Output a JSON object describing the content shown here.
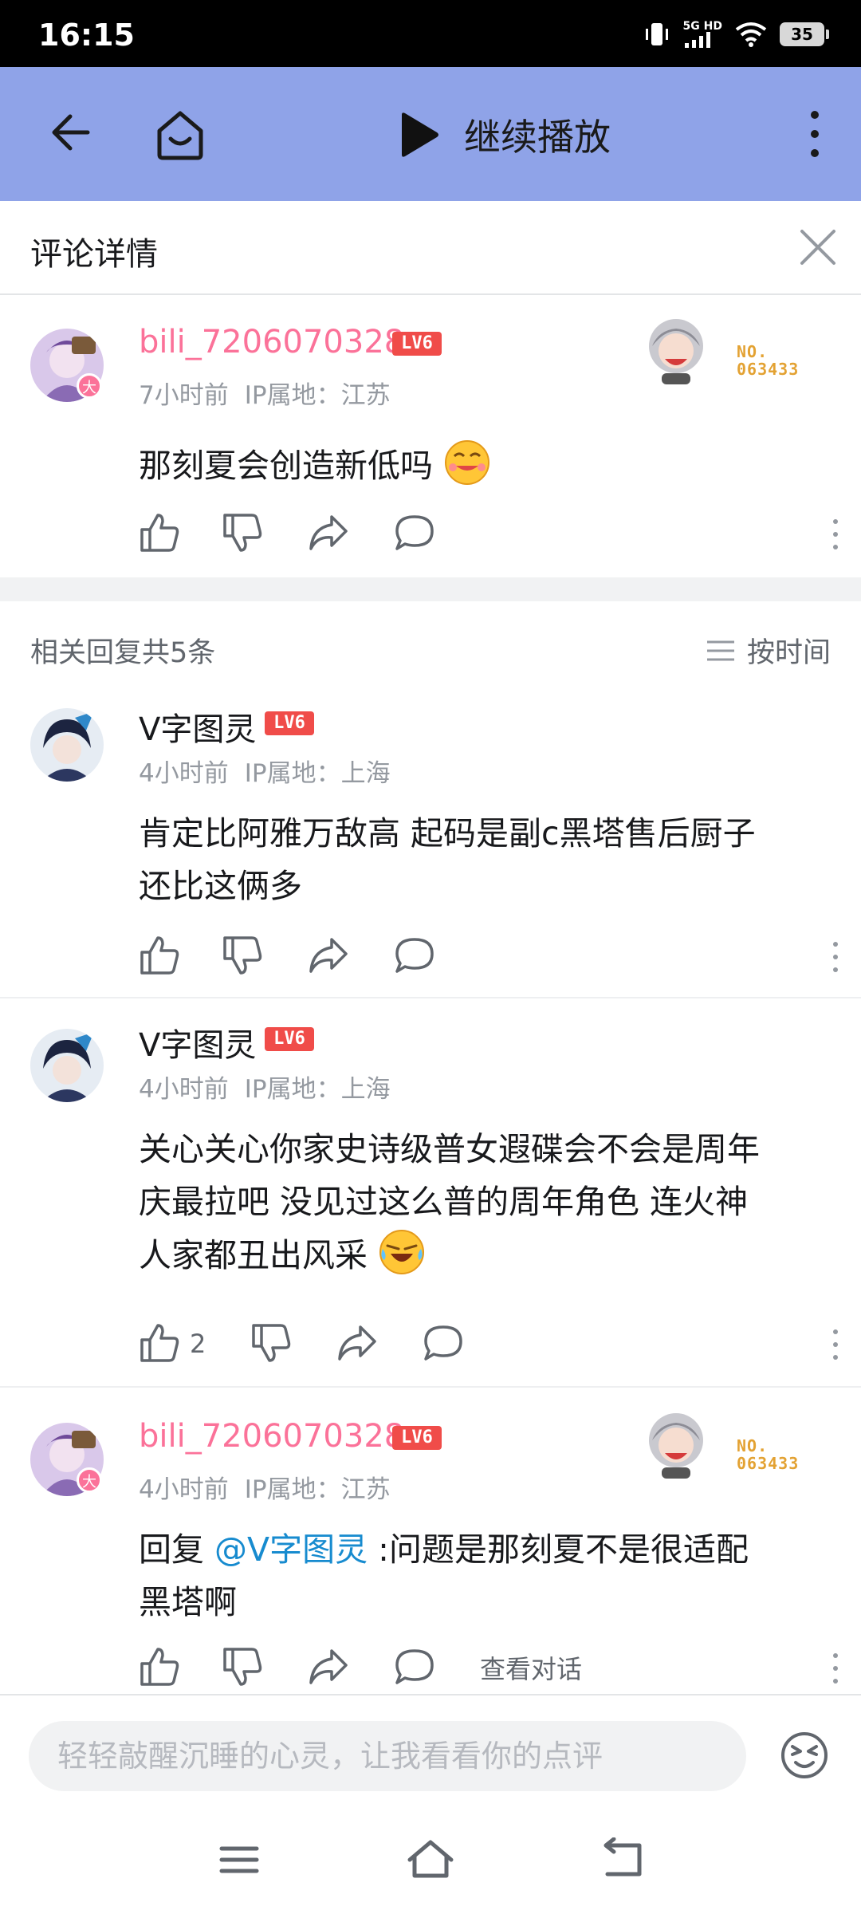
{
  "status_bar": {
    "time": "16:15",
    "network": "5G HD",
    "battery": "35"
  },
  "app_bar": {
    "back_icon": "back-arrow-icon",
    "home_icon": "home-icon",
    "play_label": "继续播放",
    "more_icon": "more-vertical-icon",
    "background": "#8fa3e8"
  },
  "detail": {
    "title": "评论详情"
  },
  "main_comment": {
    "username": "bili_7206070328",
    "level": "LV6",
    "time": "7小时前",
    "ip": "IP属地：江苏",
    "text": "那刻夏会创造新低吗",
    "badge": "大",
    "pendant_no_line1": "NO.",
    "pendant_no_line2": "063433"
  },
  "replies_header": {
    "count_label": "相关回复共5条",
    "sort_label": "按时间"
  },
  "replies": [
    {
      "username": "V字图灵",
      "level": "LV6",
      "time": "4小时前",
      "ip": "IP属地：上海",
      "text_line1": "肯定比阿雅万敌高 起码是副c黑塔售后厨子",
      "text_line2": "还比这俩多"
    },
    {
      "username": "V字图灵",
      "level": "LV6",
      "time": "4小时前",
      "ip": "IP属地：上海",
      "text_line1": "关心关心你家史诗级普女遐碟会不会是周年",
      "text_line2": "庆最拉吧 没见过这么普的周年角色 连火神",
      "text_line3": "人家都丑出风采",
      "like_count": "2"
    },
    {
      "username": "bili_7206070328",
      "level": "LV6",
      "time": "4小时前",
      "ip": "IP属地：江苏",
      "text_prefix": "回复 ",
      "mention": "@V字图灵",
      "text_line1_rest": " :问题是那刻夏不是很适配",
      "text_line2": "黑塔啊",
      "view_conversation": "查看对话",
      "badge": "大",
      "pendant_no_line1": "NO.",
      "pendant_no_line2": "063433"
    }
  ],
  "input": {
    "placeholder": "轻轻敲醒沉睡的心灵，让我看看你的点评"
  },
  "colors": {
    "pink": "#fb7299",
    "link": "#178bcf",
    "level_badge": "#f04c49",
    "pendant_text": "#e3a233"
  }
}
